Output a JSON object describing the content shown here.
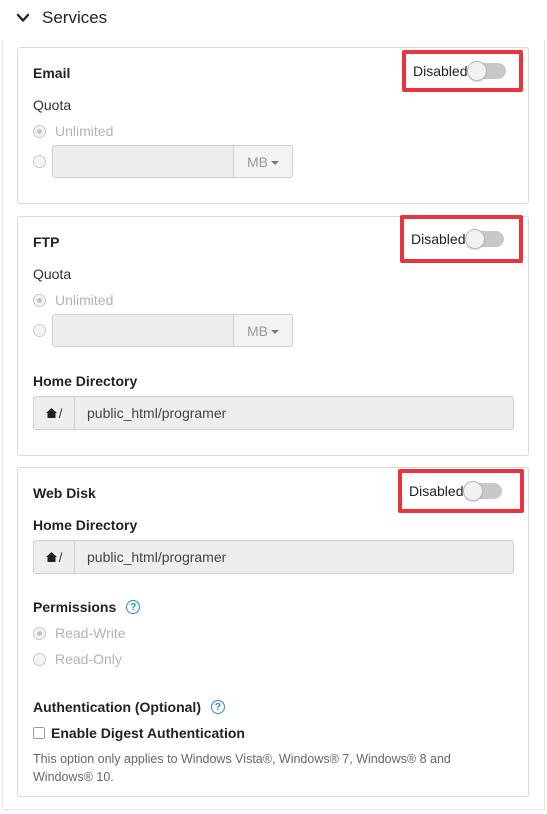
{
  "section": {
    "title": "Services"
  },
  "email": {
    "title": "Email",
    "toggle_label": "Disabled",
    "quota_label": "Quota",
    "unlimited_label": "Unlimited",
    "quota_value": "",
    "unit": "MB"
  },
  "ftp": {
    "title": "FTP",
    "toggle_label": "Disabled",
    "quota_label": "Quota",
    "unlimited_label": "Unlimited",
    "quota_value": "",
    "unit": "MB",
    "home_dir_label": "Home Directory",
    "home_prefix": "/",
    "home_dir_value": "public_html/programer"
  },
  "webdisk": {
    "title": "Web Disk",
    "toggle_label": "Disabled",
    "home_dir_label": "Home Directory",
    "home_prefix": "/",
    "home_dir_value": "public_html/programer",
    "permissions_label": "Permissions",
    "read_write_label": "Read-Write",
    "read_only_label": "Read-Only",
    "auth_label": "Authentication (Optional)",
    "digest_label": "Enable Digest Authentication",
    "note": "This option only applies to Windows Vista®, Windows® 7, Windows® 8 and Windows® 10."
  },
  "colors": {
    "highlight": "#e8343a",
    "help": "#1f8fd6",
    "toggle_off": "#c8c8c8"
  },
  "icons": {
    "section_toggle": "chevron-down-icon",
    "home": "home-icon",
    "help": "question-circle-icon",
    "caret": "caret-down-icon"
  }
}
